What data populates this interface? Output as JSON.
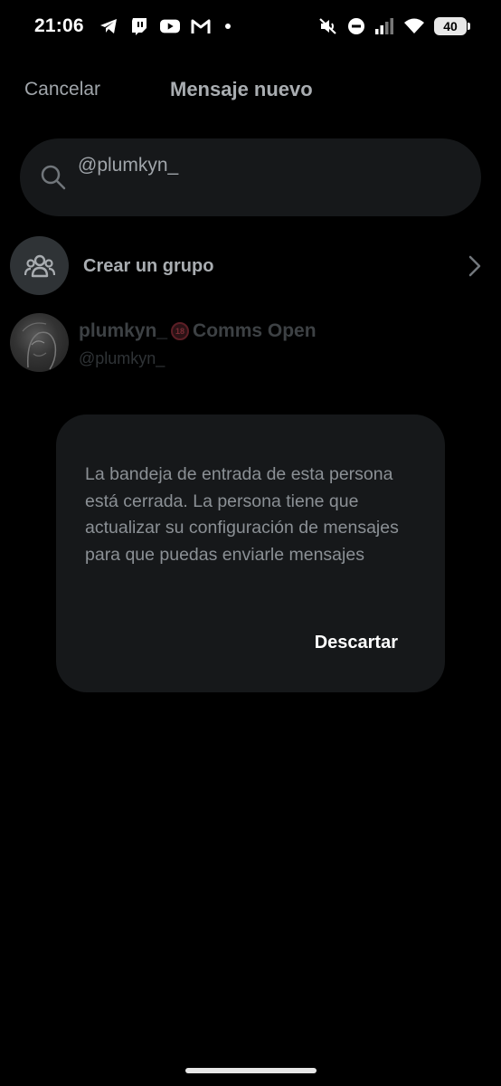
{
  "status_bar": {
    "time": "21:06",
    "battery": "40",
    "left_icons": [
      "telegram-icon",
      "twitch-icon",
      "youtube-icon",
      "gmail-icon",
      "notification-dot"
    ],
    "right_icons": [
      "muted-vibrate-icon",
      "do-not-disturb-icon",
      "cellular-signal-icon",
      "wifi-icon",
      "battery-icon"
    ]
  },
  "header": {
    "cancel_label": "Cancelar",
    "title": "Mensaje nuevo"
  },
  "search": {
    "value": "@plumkyn_",
    "icon": "search-icon"
  },
  "create_group": {
    "label": "Crear un grupo",
    "icon": "group-icon"
  },
  "user_result": {
    "name": "plumkyn_",
    "badge": "18",
    "name_suffix": "Comms Open",
    "handle": "@plumkyn_"
  },
  "dialog": {
    "message": "La bandeja de entrada de esta persona está cerrada. La persona tiene que actualizar su configuración de mensajes para que puedas enviarle mensajes",
    "dismiss_label": "Descartar"
  },
  "colors": {
    "background": "#000000",
    "surface": "#16181a",
    "primary_text": "#ffffff",
    "muted_text": "#8b9095"
  }
}
